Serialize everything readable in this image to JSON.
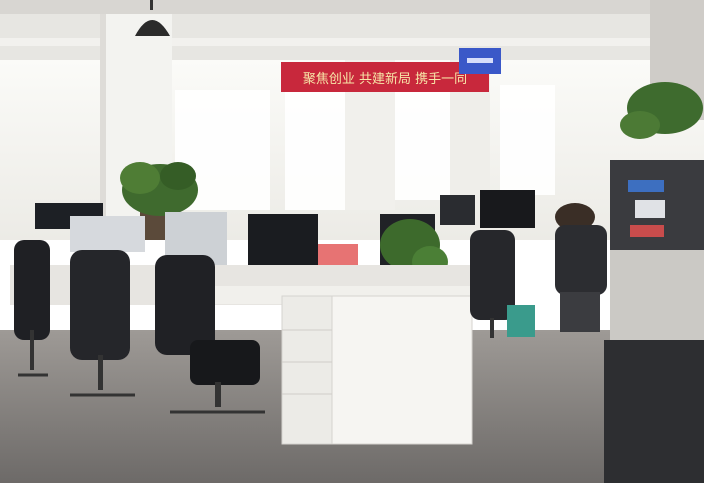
{
  "photo": {
    "banner": {
      "text": "聚焦创业 共建新局 携手一同",
      "color": "#c8283c"
    },
    "sign": {
      "text": "",
      "color": "#3a58c8"
    }
  }
}
